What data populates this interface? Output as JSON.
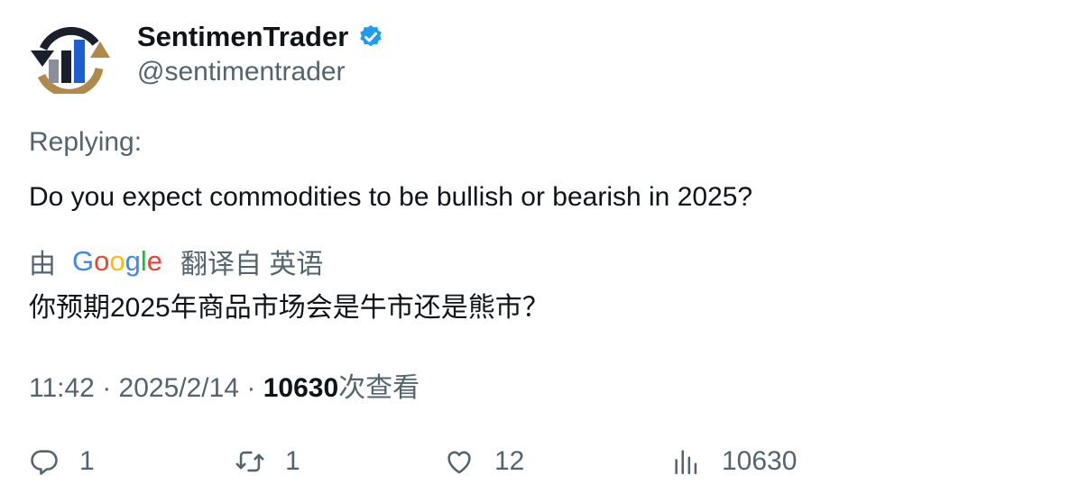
{
  "author": {
    "display_name": "SentimenTrader",
    "handle": "@sentimentrader",
    "verified_icon": "verified-badge-icon",
    "avatar_icon": "sentimentrader-logo"
  },
  "replying_label": "Replying:",
  "tweet": {
    "text": "Do you expect commodities to be bullish or bearish in 2025?"
  },
  "translation": {
    "prefix": "由",
    "provider": "Google",
    "suffix": "翻译自 英语",
    "text": "你预期2025年商品市场会是牛市还是熊市？"
  },
  "meta": {
    "time": "11:42",
    "separator": "·",
    "date": "2025/2/14",
    "views_count": "10630",
    "views_label": "次查看"
  },
  "actions": {
    "replies": "1",
    "retweets": "1",
    "likes": "12",
    "views": "10630"
  },
  "colors": {
    "text": "#0f1419",
    "secondary": "#536471",
    "verified": "#1d9bf0"
  }
}
